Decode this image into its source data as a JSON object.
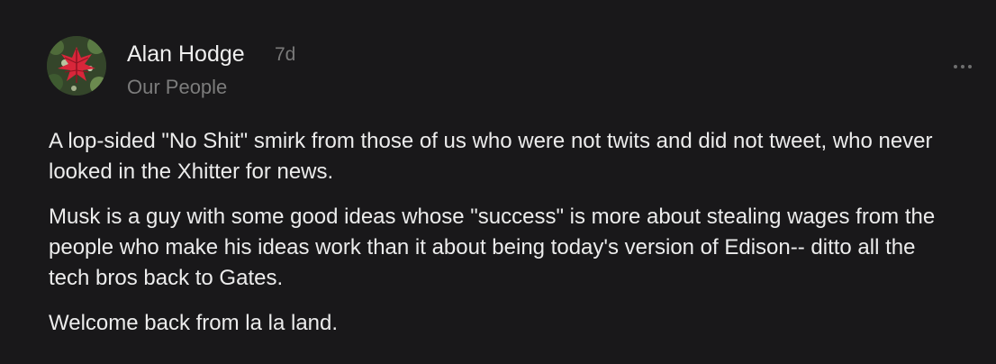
{
  "comment": {
    "author": {
      "name": "Alan Hodge",
      "subtitle": "Our People",
      "avatar_icon": "red-leaf-avatar"
    },
    "timestamp": "7d",
    "more_icon": "ellipsis-icon",
    "paragraphs": [
      "A lop-sided \"No Shit\" smirk from those of us who were not twits and did not tweet, who never looked in the Xhitter for news.",
      "Musk is a guy with some good ideas whose \"success\" is more about stealing wages from the people who make his ideas work than it about being today's version of Edison-- ditto all the tech bros back to Gates.",
      "Welcome back from la la land."
    ]
  },
  "colors": {
    "background": "#19181a",
    "text": "#ececec",
    "muted": "#7c7c7c"
  }
}
